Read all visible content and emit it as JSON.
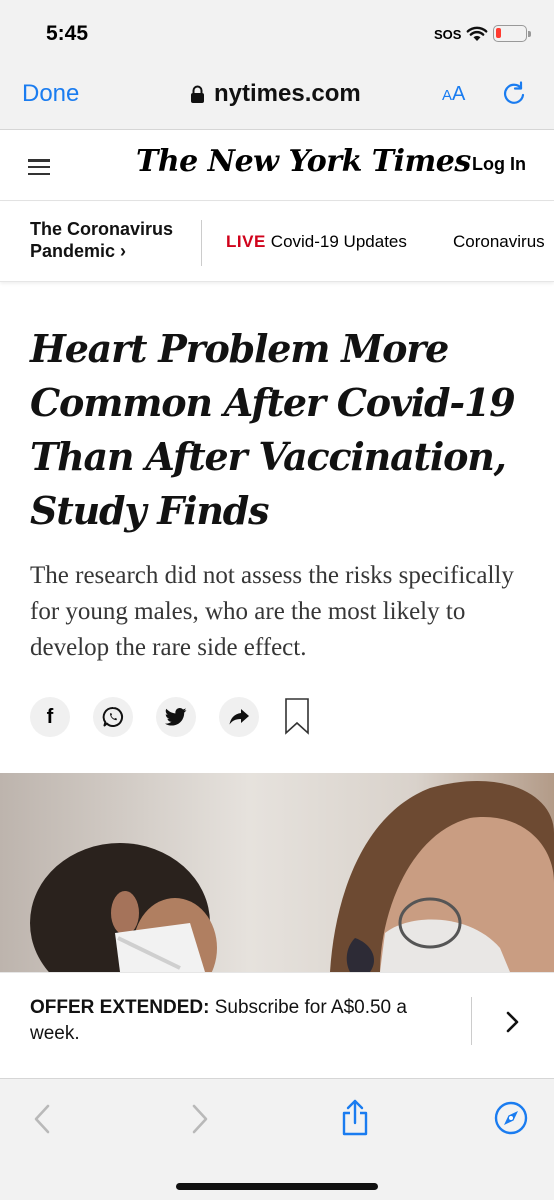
{
  "status_bar": {
    "time": "5:45",
    "carrier": "SOS",
    "battery_color": "#ff3b30"
  },
  "safari": {
    "done_label": "Done",
    "url": "nytimes.com",
    "reader_label_small": "A",
    "reader_label_large": "A",
    "accent_color": "#1a7cf0"
  },
  "nyt_header": {
    "logo_text": "The New York Times",
    "login_label": "Log In"
  },
  "section_nav": {
    "section_title": "The Coronavirus Pandemic ›",
    "live_label": "LIVE",
    "live_link": "Covid-19 Updates",
    "next_link": "Coronavirus",
    "live_color": "#d0021b"
  },
  "article": {
    "headline": "Heart Problem More Common After Covid-19 Than After Vaccination, Study Finds",
    "summary": "The research did not assess the risks specifically for young males, who are the most likely to develop the rare side effect."
  },
  "share": {
    "facebook_glyph": "f"
  },
  "offer": {
    "label": "OFFER EXTENDED:",
    "text": " Subscribe for A$0.50 a week."
  }
}
